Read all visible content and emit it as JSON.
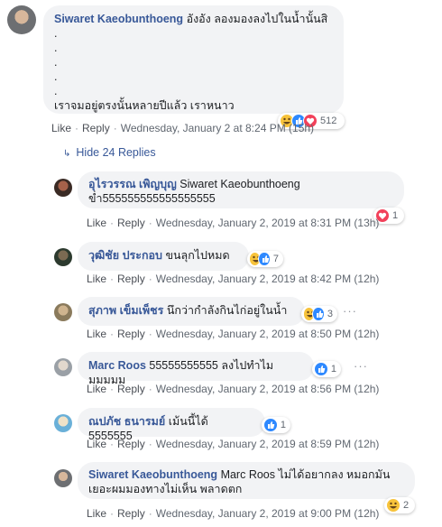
{
  "main": {
    "author": "Siwaret Kaeobunthoeng",
    "text": "อังอัง ลองมองลงไปในน้ำนั้นสิ",
    "dots": [
      ".",
      ".",
      ".",
      ".",
      "."
    ],
    "text2": "เราจมอยู่ตรงนั้นหลายปีแล้ว เราหนาว",
    "like": "Like",
    "reply": "Reply",
    "time": "Wednesday, January 2 at 8:24 PM (15h)",
    "reaction_count": "512"
  },
  "hide_replies": "Hide 24 Replies",
  "replies": [
    {
      "author": "อุไรวรรณ เพิญบุญ",
      "text": "Siwaret Kaeobunthoeng",
      "text2": "ข่ำ555555555555555555",
      "like": "Like",
      "reply": "Reply",
      "time": "Wednesday, January 2, 2019 at 8:31 PM (13h)",
      "reaction_count": "1",
      "reactions": [
        "heart-icon"
      ]
    },
    {
      "author": "วุฒิชัย ประกอบ",
      "text": "ขนลุกไปหมด",
      "like": "Like",
      "reply": "Reply",
      "time": "Wednesday, January 2, 2019 at 8:42 PM (12h)",
      "reaction_count": "7",
      "reactions": [
        "haha-icon",
        "like-icon"
      ]
    },
    {
      "author": "สุภาพ เข็มเพ็ชร",
      "text": "นึกว่ากำลังกินไก่อยู่ในน้ำ",
      "like": "Like",
      "reply": "Reply",
      "time": "Wednesday, January 2, 2019 at 8:50 PM (12h)",
      "reaction_count": "3",
      "reactions": [
        "haha-icon",
        "like-icon"
      ]
    },
    {
      "author": "Marc Roos",
      "text": "55555555555 ลงไปทำไมมมมมม",
      "like": "Like",
      "reply": "Reply",
      "time": "Wednesday, January 2, 2019 at 8:56 PM (12h)",
      "reaction_count": "1",
      "reactions": [
        "like-icon"
      ]
    },
    {
      "author": "ณปภัช ธนารมย์",
      "text": "เม้นนี้ได้ 5555555",
      "like": "Like",
      "reply": "Reply",
      "time": "Wednesday, January 2, 2019 at 8:59 PM (12h)",
      "reaction_count": "1",
      "reactions": [
        "like-icon"
      ]
    },
    {
      "author": "Siwaret Kaeobunthoeng",
      "text": "Marc Roos ไม่ได้อยากลง หมอกมัน",
      "text2": "เยอะผมมองทางไม่เห็น พลาดตก",
      "like": "Like",
      "reply": "Reply",
      "time": "Wednesday, January 2, 2019 at 9:00 PM (12h)",
      "reaction_count": "2",
      "reactions": [
        "haha-icon"
      ]
    }
  ],
  "more_options": "···"
}
